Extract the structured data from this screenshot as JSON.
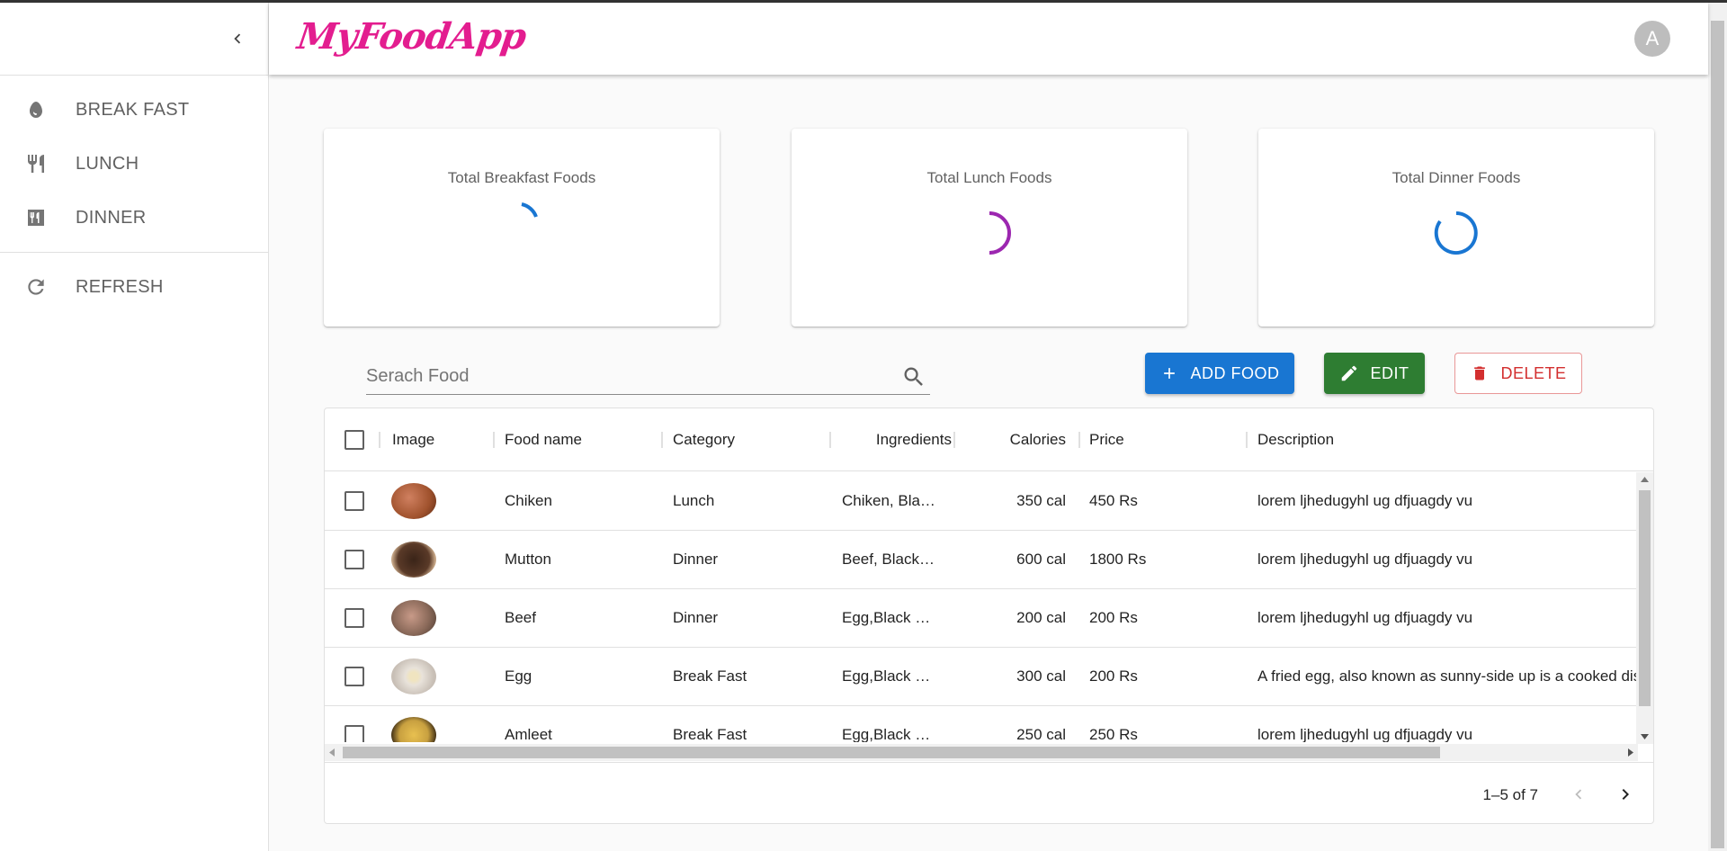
{
  "app": {
    "name": "MyFoodApp",
    "avatar_letter": "A",
    "brand_color": "#e31d8f"
  },
  "sidebar": {
    "collapse_icon": "chevron-left-icon",
    "items": [
      {
        "label": "BREAK FAST",
        "icon": "egg-icon"
      },
      {
        "label": "LUNCH",
        "icon": "restaurant-icon"
      },
      {
        "label": "DINNER",
        "icon": "dining-icon"
      }
    ],
    "refresh": {
      "label": "REFRESH",
      "icon": "refresh-icon"
    }
  },
  "summary": [
    {
      "title": "Total Breakfast Foods",
      "spinner_color": "#1976d2"
    },
    {
      "title": "Total Lunch Foods",
      "spinner_color": "#9c27b0"
    },
    {
      "title": "Total Dinner Foods",
      "spinner_color": "#1976d2"
    }
  ],
  "search": {
    "placeholder": "Serach Food",
    "value": ""
  },
  "actions": {
    "add": "ADD FOOD",
    "edit": "EDIT",
    "delete": "DELETE"
  },
  "table": {
    "columns": [
      "Image",
      "Food name",
      "Category",
      "Ingredients",
      "Calories",
      "Price",
      "Description"
    ],
    "rows": [
      {
        "name": "Chiken",
        "category": "Lunch",
        "ingredients": "Chiken, Bla…",
        "calories": "350 cal",
        "price": "450 Rs",
        "description": "lorem ljhedugyhl ug dfjuagdy vu",
        "img_color": "#a0522d"
      },
      {
        "name": "Mutton",
        "category": "Dinner",
        "ingredients": "Beef, Black…",
        "calories": "600 cal",
        "price": "1800 Rs",
        "description": "lorem ljhedugyhl ug dfjuagdy vu",
        "img_color": "#5a3a28"
      },
      {
        "name": "Beef",
        "category": "Dinner",
        "ingredients": "Egg,Black …",
        "calories": "200 cal",
        "price": "200 Rs",
        "description": "lorem ljhedugyhl ug dfjuagdy vu",
        "img_color": "#8b6a5a"
      },
      {
        "name": "Egg",
        "category": "Break Fast",
        "ingredients": "Egg,Black …",
        "calories": "300 cal",
        "price": "200 Rs",
        "description": "A fried egg, also known as sunny-side up is a cooked dish",
        "img_color": "#d8cfc6"
      },
      {
        "name": "Amleet",
        "category": "Break Fast",
        "ingredients": "Egg,Black …",
        "calories": "250 cal",
        "price": "250 Rs",
        "description": "lorem ljhedugyhl ug dfjuagdy vu",
        "img_color": "#c8a040"
      }
    ],
    "pagination": "1–5 of 7"
  }
}
